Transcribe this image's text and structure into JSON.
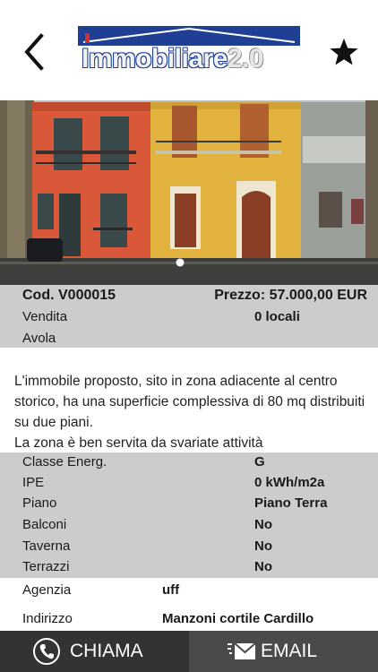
{
  "header": {
    "back_icon": "chevron-left-icon",
    "favorite_icon": "star-icon",
    "logo_text": "Immobiliare",
    "logo_version": "2.0"
  },
  "gallery": {
    "active_slide": 1,
    "slide_count": 1
  },
  "summary": {
    "code": "Cod. V000015",
    "price": "Prezzo: 57.000,00 EUR",
    "contract": "Vendita",
    "rooms": "0 locali",
    "city": "Avola"
  },
  "description": "L'immobile proposto, sito in zona adiacente al centro storico, ha una superficie complessiva di 80 mq distribuiti su due piani.\nLa zona è ben servita da svariate attività",
  "specs": [
    {
      "label": "Classe Energ.",
      "value": "G"
    },
    {
      "label": "IPE",
      "value": "0 kWh/m2a"
    },
    {
      "label": "Piano",
      "value": "Piano Terra"
    },
    {
      "label": "Balconi",
      "value": "No"
    },
    {
      "label": "Taverna",
      "value": "No"
    },
    {
      "label": "Terrazzi",
      "value": "No"
    }
  ],
  "extra": [
    {
      "label": "Agenzia",
      "value": "uff"
    },
    {
      "label": "Indirizzo",
      "value": "Manzoni cortile Cardillo"
    }
  ],
  "footer": {
    "call_label": "CHIAMA",
    "email_label": "EMAIL",
    "call_icon": "phone-icon",
    "email_icon": "envelope-icon",
    "call_bg": "#333333",
    "email_bg": "#4a4a4a"
  },
  "colors": {
    "brand": "#1e3f94",
    "panel_gray": "#cccccc"
  }
}
